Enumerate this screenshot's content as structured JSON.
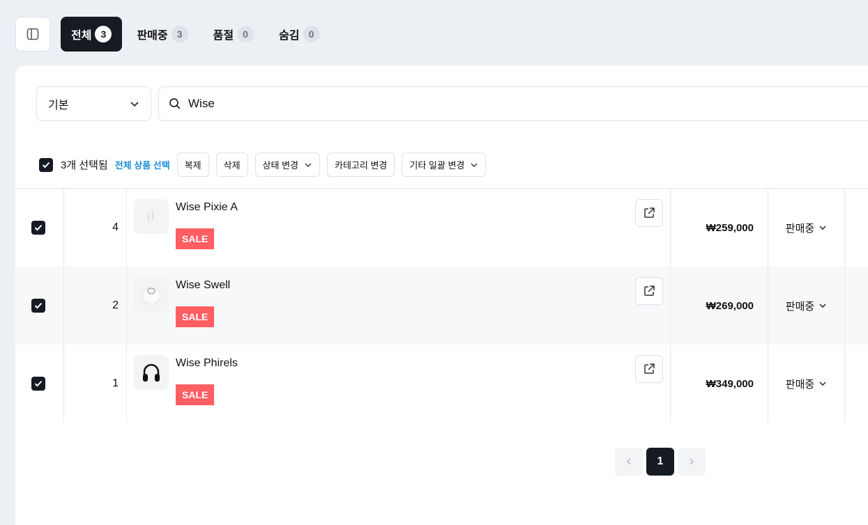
{
  "tabs": [
    {
      "label": "전체",
      "count": "3"
    },
    {
      "label": "판매중",
      "count": "3"
    },
    {
      "label": "품절",
      "count": "0"
    },
    {
      "label": "숨김",
      "count": "0"
    }
  ],
  "filter": {
    "select_value": "기본",
    "search_value": "Wise"
  },
  "bulk": {
    "selected_label": "3개 선택됨",
    "select_all_link": "전체 상품 선택",
    "buttons": [
      "복제",
      "삭제",
      "상태 변경",
      "카테고리 변경",
      "기타 일괄 변경"
    ]
  },
  "rows": [
    {
      "num": "4",
      "name": "Wise Pixie A",
      "badge": "SALE",
      "price": "₩259,000",
      "status": "판매중",
      "image": "earbuds"
    },
    {
      "num": "2",
      "name": "Wise Swell",
      "badge": "SALE",
      "price": "₩269,000",
      "status": "판매중",
      "image": "speaker"
    },
    {
      "num": "1",
      "name": "Wise Phirels",
      "badge": "SALE",
      "price": "₩349,000",
      "status": "판매중",
      "image": "headphones"
    }
  ],
  "pagination": {
    "current": "1"
  },
  "colors": {
    "accent": "#161a22",
    "sale": "#ff5e63",
    "link": "#1a8fd6"
  }
}
